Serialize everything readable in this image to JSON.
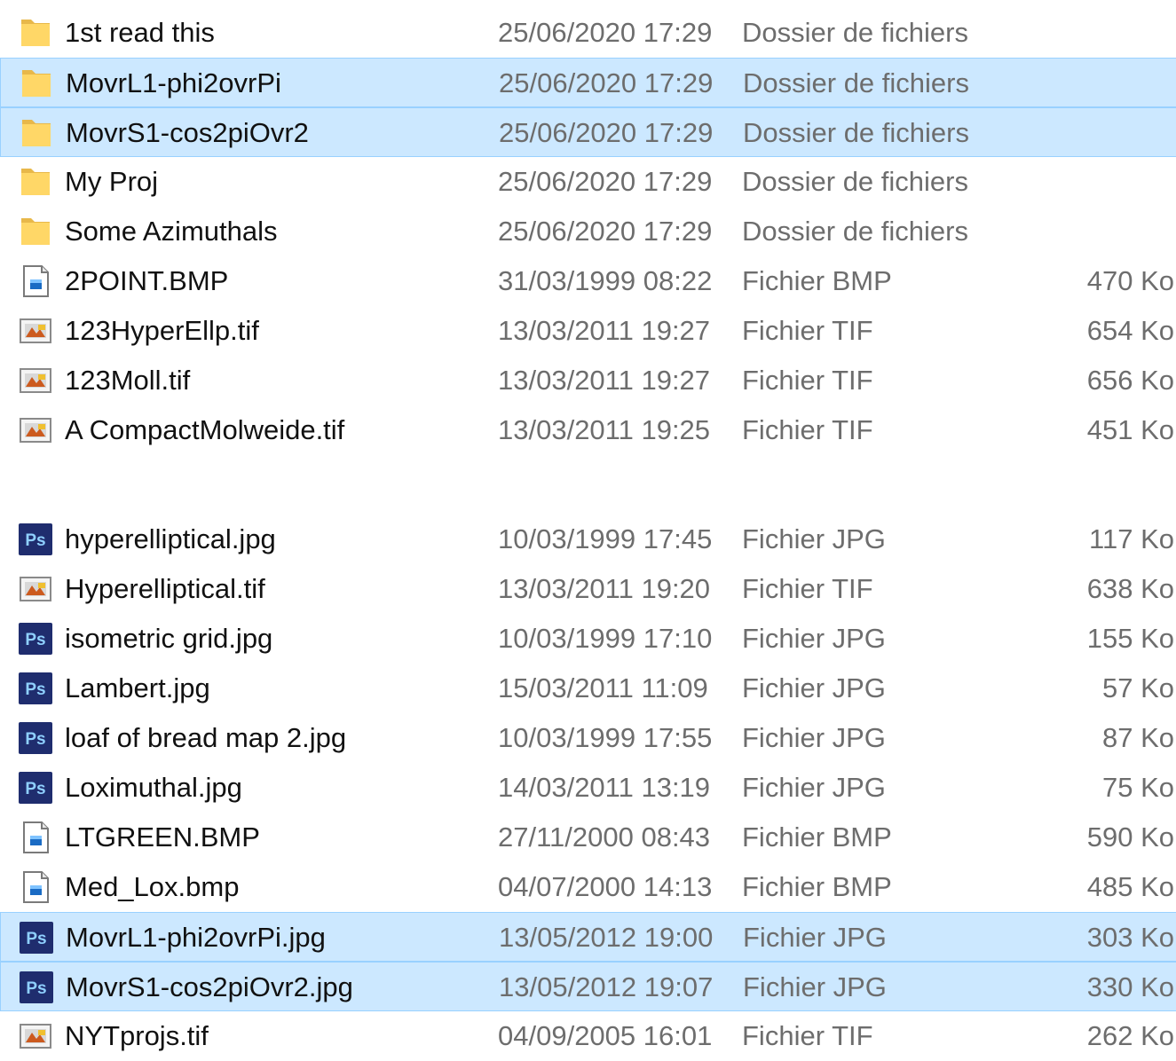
{
  "files": [
    {
      "name": "1st read this",
      "date": "25/06/2020 17:29",
      "type": "Dossier de fichiers",
      "size": "",
      "icon": "folder-icon",
      "selected": false
    },
    {
      "name": "MovrL1-phi2ovrPi",
      "date": "25/06/2020 17:29",
      "type": "Dossier de fichiers",
      "size": "",
      "icon": "folder-icon",
      "selected": true
    },
    {
      "name": "MovrS1-cos2piOvr2",
      "date": "25/06/2020 17:29",
      "type": "Dossier de fichiers",
      "size": "",
      "icon": "folder-icon",
      "selected": true
    },
    {
      "name": "My Proj",
      "date": "25/06/2020 17:29",
      "type": "Dossier de fichiers",
      "size": "",
      "icon": "folder-icon",
      "selected": false
    },
    {
      "name": "Some Azimuthals",
      "date": "25/06/2020 17:29",
      "type": "Dossier de fichiers",
      "size": "",
      "icon": "folder-icon",
      "selected": false
    },
    {
      "name": "2POINT.BMP",
      "date": "31/03/1999 08:22",
      "type": "Fichier BMP",
      "size": "470 Ko",
      "icon": "bmp-file-icon",
      "selected": false
    },
    {
      "name": "123HyperEllp.tif",
      "date": "13/03/2011 19:27",
      "type": "Fichier TIF",
      "size": "654 Ko",
      "icon": "tif-file-icon",
      "selected": false
    },
    {
      "name": "123Moll.tif",
      "date": "13/03/2011 19:27",
      "type": "Fichier TIF",
      "size": "656 Ko",
      "icon": "tif-file-icon",
      "selected": false
    },
    {
      "name": "A CompactMolweide.tif",
      "date": "13/03/2011 19:25",
      "type": "Fichier TIF",
      "size": "451 Ko",
      "icon": "tif-file-icon",
      "selected": false
    },
    {
      "name": "hyperelliptical.jpg",
      "date": "10/03/1999 17:45",
      "type": "Fichier JPG",
      "size": "117 Ko",
      "icon": "photoshop-file-icon",
      "selected": false
    },
    {
      "name": "Hyperelliptical.tif",
      "date": "13/03/2011 19:20",
      "type": "Fichier TIF",
      "size": "638 Ko",
      "icon": "tif-file-icon",
      "selected": false
    },
    {
      "name": "isometric grid.jpg",
      "date": "10/03/1999 17:10",
      "type": "Fichier JPG",
      "size": "155 Ko",
      "icon": "photoshop-file-icon",
      "selected": false
    },
    {
      "name": "Lambert.jpg",
      "date": "15/03/2011 11:09",
      "type": "Fichier JPG",
      "size": "57 Ko",
      "icon": "photoshop-file-icon",
      "selected": false
    },
    {
      "name": "loaf of bread map 2.jpg",
      "date": "10/03/1999 17:55",
      "type": "Fichier JPG",
      "size": "87 Ko",
      "icon": "photoshop-file-icon",
      "selected": false
    },
    {
      "name": "Loximuthal.jpg",
      "date": "14/03/2011 13:19",
      "type": "Fichier JPG",
      "size": "75 Ko",
      "icon": "photoshop-file-icon",
      "selected": false
    },
    {
      "name": "LTGREEN.BMP",
      "date": "27/11/2000 08:43",
      "type": "Fichier BMP",
      "size": "590 Ko",
      "icon": "bmp-file-icon",
      "selected": false
    },
    {
      "name": "Med_Lox.bmp",
      "date": "04/07/2000 14:13",
      "type": "Fichier BMP",
      "size": "485 Ko",
      "icon": "bmp-file-icon",
      "selected": false
    },
    {
      "name": "MovrL1-phi2ovrPi.jpg",
      "date": "13/05/2012 19:00",
      "type": "Fichier JPG",
      "size": "303 Ko",
      "icon": "photoshop-file-icon",
      "selected": true
    },
    {
      "name": "MovrS1-cos2piOvr2.jpg",
      "date": "13/05/2012 19:07",
      "type": "Fichier JPG",
      "size": "330 Ko",
      "icon": "photoshop-file-icon",
      "selected": true
    },
    {
      "name": "NYTprojs.tif",
      "date": "04/09/2005 16:01",
      "type": "Fichier TIF",
      "size": "262 Ko",
      "icon": "tif-file-icon",
      "selected": false
    }
  ],
  "colors": {
    "selection_bg": "#cce8ff",
    "selection_border": "#99d1ff",
    "name_text": "#111111",
    "detail_text": "#6d6d6d",
    "folder": "#ffd767",
    "photoshop_bg": "#1f2d6e",
    "photoshop_text": "#8fd0ff"
  }
}
